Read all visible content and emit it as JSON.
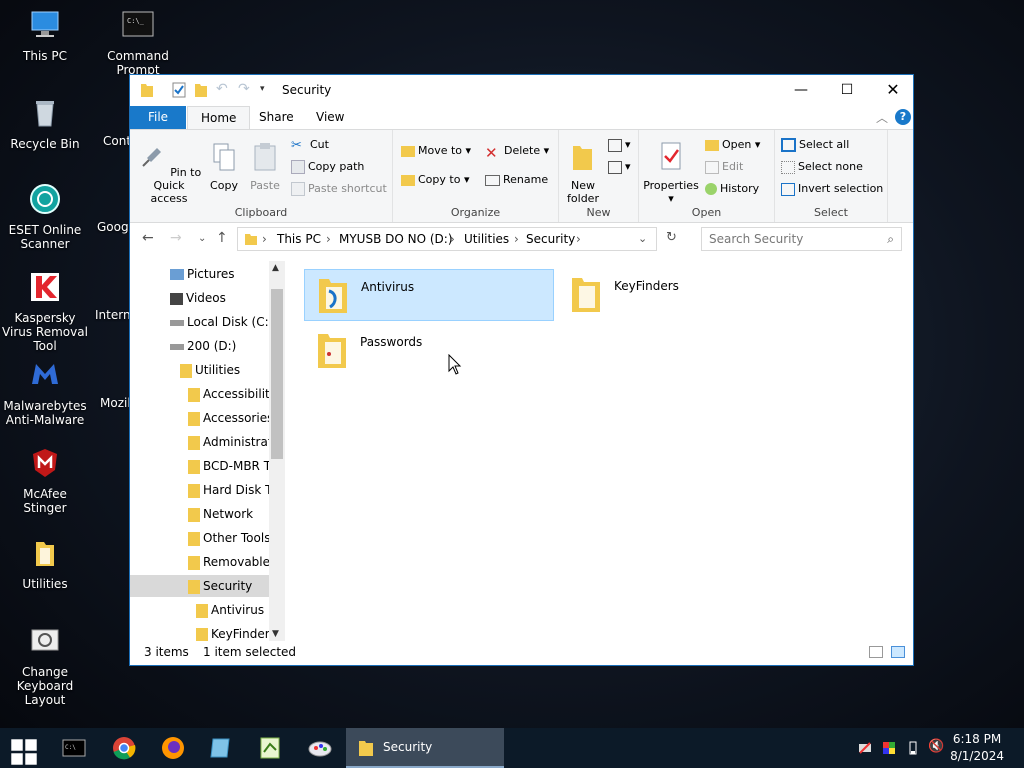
{
  "desktop": {
    "icons": [
      {
        "label": "This PC"
      },
      {
        "label": "Command Prompt"
      },
      {
        "label": "Recycle Bin"
      },
      {
        "label": "Cont"
      },
      {
        "label": "ESET Online Scanner"
      },
      {
        "label": "Googl"
      },
      {
        "label": "Kaspersky Virus Removal Tool"
      },
      {
        "label": "Interne"
      },
      {
        "label": "Malwarebytes Anti-Malware"
      },
      {
        "label": "Mozil"
      },
      {
        "label": "McAfee Stinger"
      },
      {
        "label": "Utilities"
      },
      {
        "label": "Change Keyboard Layout"
      }
    ]
  },
  "window": {
    "title": "Security",
    "tabs": {
      "file": "File",
      "home": "Home",
      "share": "Share",
      "view": "View"
    },
    "ribbon": {
      "clipboard": {
        "label": "Clipboard",
        "pin": "Pin to Quick access",
        "copy": "Copy",
        "paste": "Paste",
        "cut": "Cut",
        "copy_path": "Copy path",
        "paste_shortcut": "Paste shortcut"
      },
      "organize": {
        "label": "Organize",
        "move_to": "Move to",
        "copy_to": "Copy to",
        "delete": "Delete",
        "rename": "Rename"
      },
      "new": {
        "label": "New",
        "new_folder": "New folder"
      },
      "open": {
        "label": "Open",
        "properties": "Properties",
        "open": "Open",
        "edit": "Edit",
        "history": "History"
      },
      "select": {
        "label": "Select",
        "select_all": "Select all",
        "select_none": "Select none",
        "invert": "Invert selection"
      }
    },
    "address": {
      "crumbs": [
        "This PC",
        "MYUSB DO NO (D:)",
        "Utilities",
        "Security"
      ]
    },
    "search": {
      "placeholder": "Search Security"
    },
    "nav": [
      {
        "label": "Pictures"
      },
      {
        "label": "Videos"
      },
      {
        "label": "Local Disk (C:)"
      },
      {
        "label": "200 (D:)"
      },
      {
        "label": "Utilities"
      },
      {
        "label": "Accessibility"
      },
      {
        "label": "Accessories"
      },
      {
        "label": "Administrat"
      },
      {
        "label": "BCD-MBR T"
      },
      {
        "label": "Hard Disk To"
      },
      {
        "label": "Network"
      },
      {
        "label": "Other Tools"
      },
      {
        "label": "Removable"
      },
      {
        "label": "Security"
      },
      {
        "label": "Antivirus"
      },
      {
        "label": "KeyFinders"
      }
    ],
    "files": [
      {
        "name": "Antivirus"
      },
      {
        "name": "KeyFinders"
      },
      {
        "name": "Passwords"
      }
    ],
    "status": {
      "count": "3 items",
      "selected": "1 item selected"
    }
  },
  "taskbar": {
    "active_window": "Security",
    "time": "6:18 PM",
    "date": "8/1/2024"
  },
  "colors": {
    "accent": "#1979ca",
    "selection": "#cce8ff",
    "taskbar": "#0c1a28"
  }
}
